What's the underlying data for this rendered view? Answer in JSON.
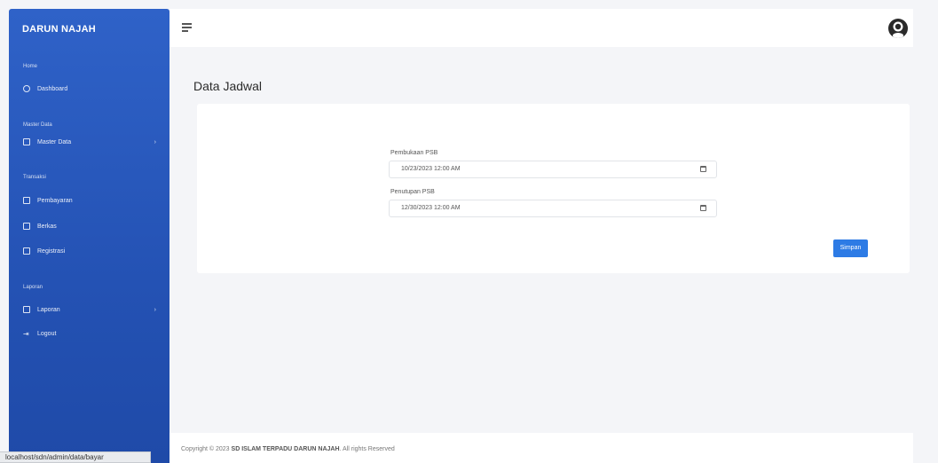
{
  "sidebar": {
    "brand": "DARUN NAJAH",
    "sections": [
      {
        "heading": "Home"
      },
      {
        "heading": "Master Data"
      },
      {
        "heading": "Transaksi"
      },
      {
        "heading": "Laporan"
      }
    ],
    "items": [
      {
        "label": "Dashboard",
        "icon": "home-icon"
      },
      {
        "label": "Master Data",
        "icon": "table-icon"
      },
      {
        "label": "Pembayaran",
        "icon": "file-icon"
      },
      {
        "label": "Berkas",
        "icon": "file-icon"
      },
      {
        "label": "Registrasi",
        "icon": "file-icon"
      },
      {
        "label": "Laporan",
        "icon": "report-icon"
      },
      {
        "label": "Logout",
        "icon": "logout-icon"
      }
    ],
    "accent": "#2f62c8"
  },
  "status_bar": {
    "url": "localhost/sdn/admin/data/bayar"
  },
  "main": {
    "title": "Data Jadwal",
    "fields": [
      {
        "label": "Pembukaan PSB",
        "value": "10/23/2023 12:00 AM"
      },
      {
        "label": "Penutupan PSB",
        "value": "12/30/2023 12:00 AM"
      }
    ],
    "save_label": "Simpan",
    "save_color": "#2d7be5"
  },
  "footer": {
    "prefix": "Copyright © 2023",
    "brand": "SD ISLAM TERPADU DARUN NAJAH",
    "suffix": ". All rights Reserved"
  }
}
